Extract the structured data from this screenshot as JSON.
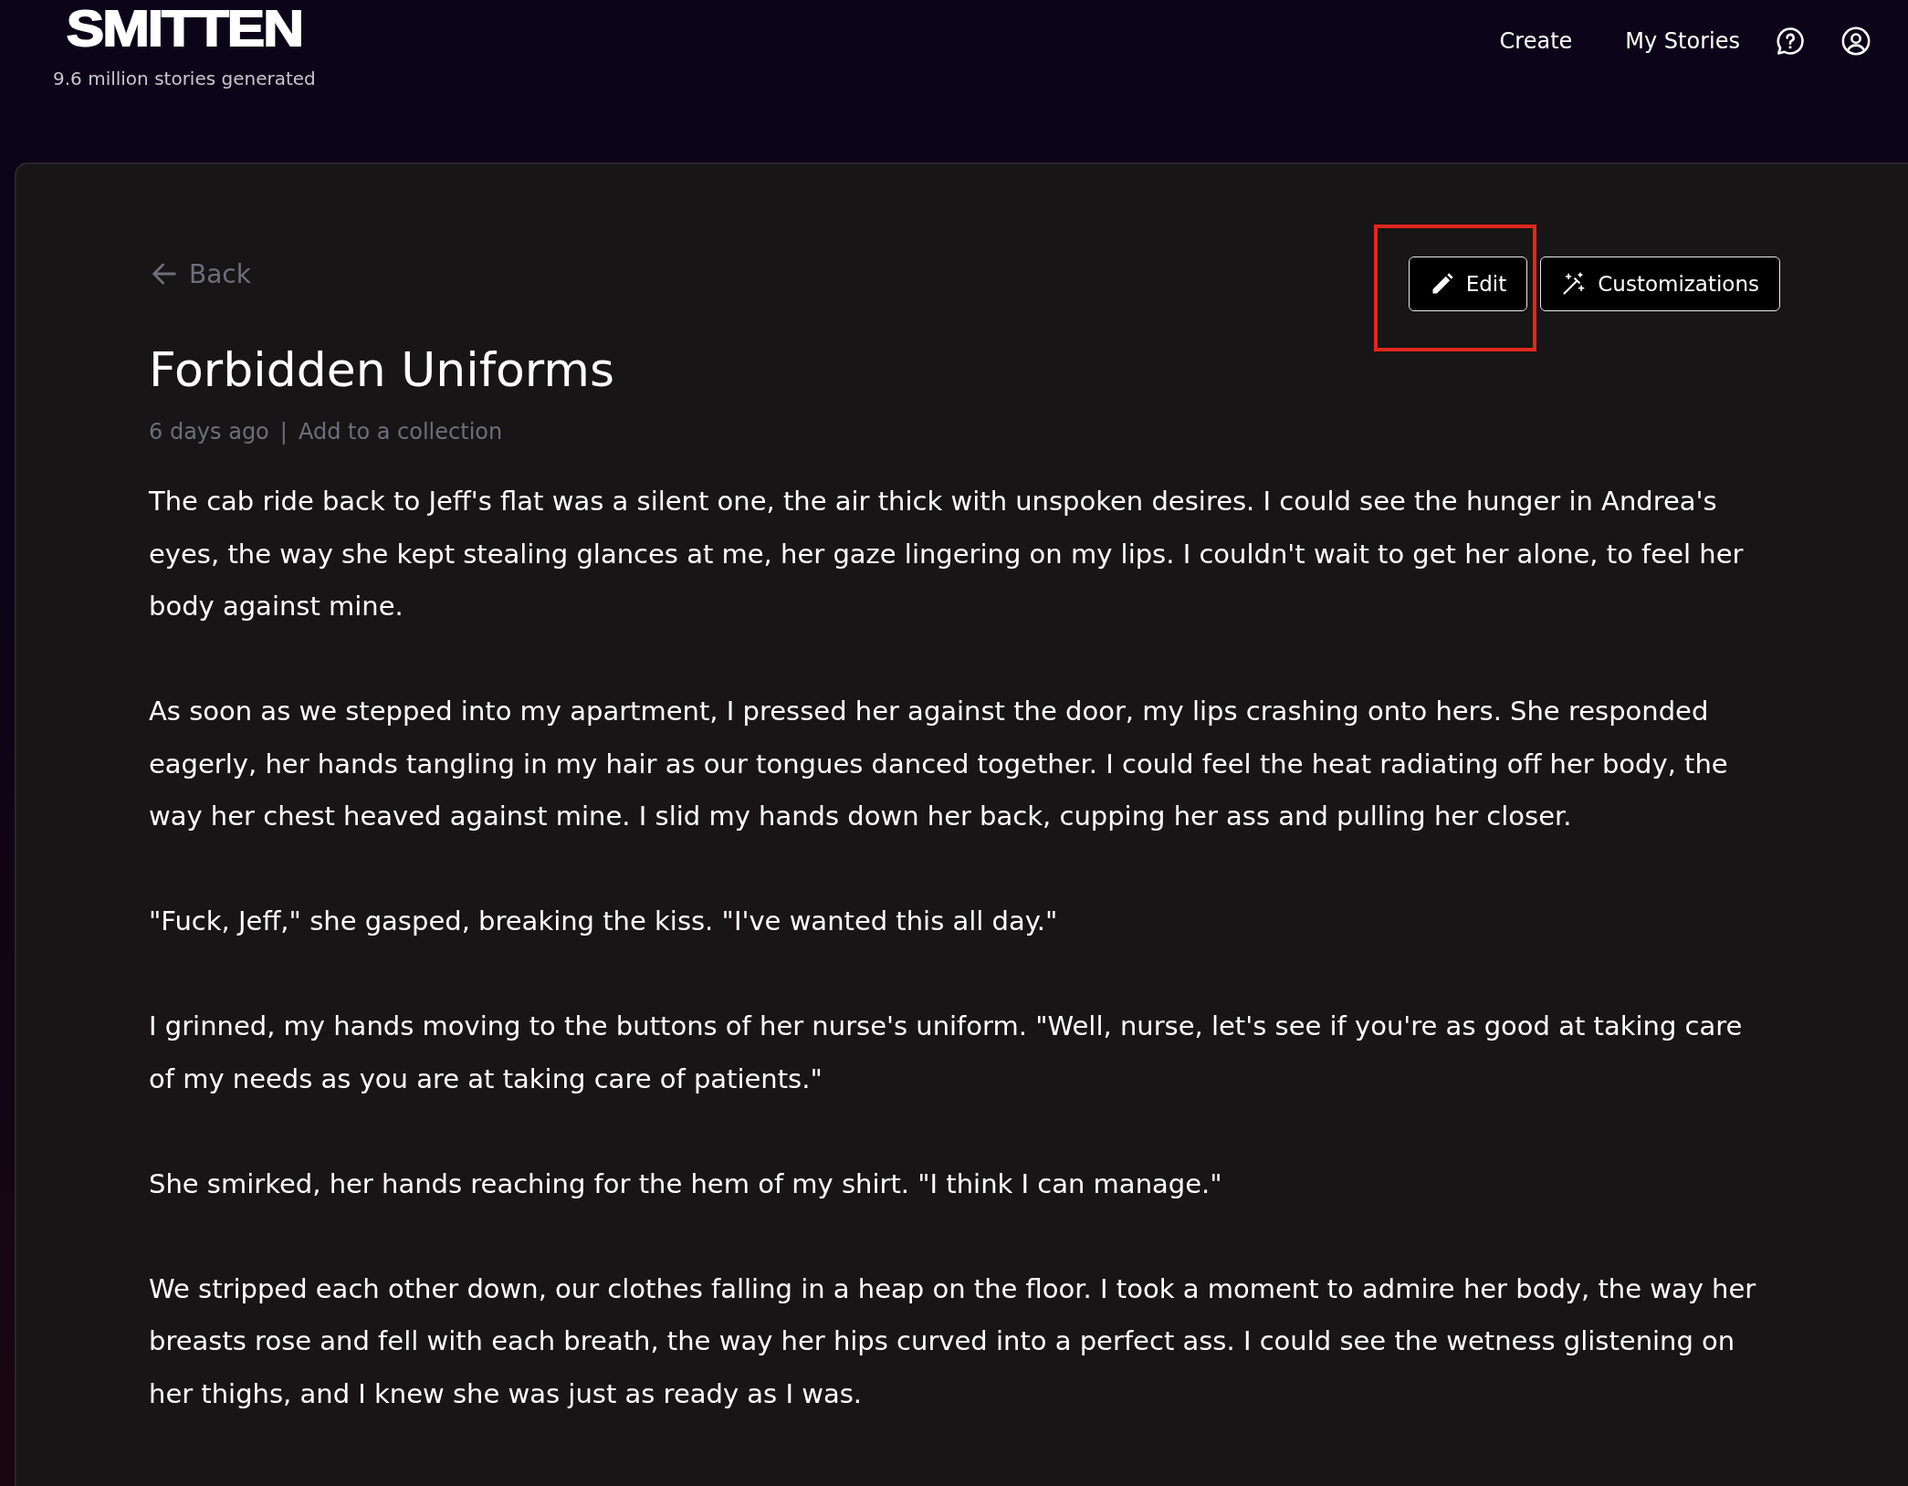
{
  "header": {
    "logo": "SMITTEN",
    "tagline": "9.6 million stories generated",
    "nav": [
      {
        "label": "Create"
      },
      {
        "label": "My Stories"
      }
    ]
  },
  "story": {
    "back": "Back",
    "title": "Forbidden Uniforms",
    "age": "6 days ago",
    "separator": "|",
    "collection_link": "Add to a collection",
    "actions": [
      {
        "kind": "edit",
        "label": "Edit",
        "highlighted": true
      },
      {
        "kind": "customize",
        "label": "Customizations",
        "highlighted": false
      }
    ],
    "paragraphs": [
      "The cab ride back to Jeff's flat was a silent one, the air thick with unspoken desires. I could see the hunger in Andrea's eyes, the way she kept stealing glances at me, her gaze lingering on my lips. I couldn't wait to get her alone, to feel her body against mine.",
      "As soon as we stepped into my apartment, I pressed her against the door, my lips crashing onto hers. She responded eagerly, her hands tangling in my hair as our tongues danced together. I could feel the heat radiating off her body, the way her chest heaved against mine. I slid my hands down her back, cupping her ass and pulling her closer.",
      "\"Fuck, Jeff,\" she gasped, breaking the kiss. \"I've wanted this all day.\"",
      "I grinned, my hands moving to the buttons of her nurse's uniform. \"Well, nurse, let's see if you're as good at taking care of my needs as you are at taking care of patients.\"",
      "She smirked, her hands reaching for the hem of my shirt. \"I think I can manage.\"",
      "We stripped each other down, our clothes falling in a heap on the floor. I took a moment to admire her body, the way her breasts rose and fell with each breath, the way her hips curved into a perfect ass. I could see the wetness glistening on her thighs, and I knew she was just as ready as I was."
    ]
  }
}
